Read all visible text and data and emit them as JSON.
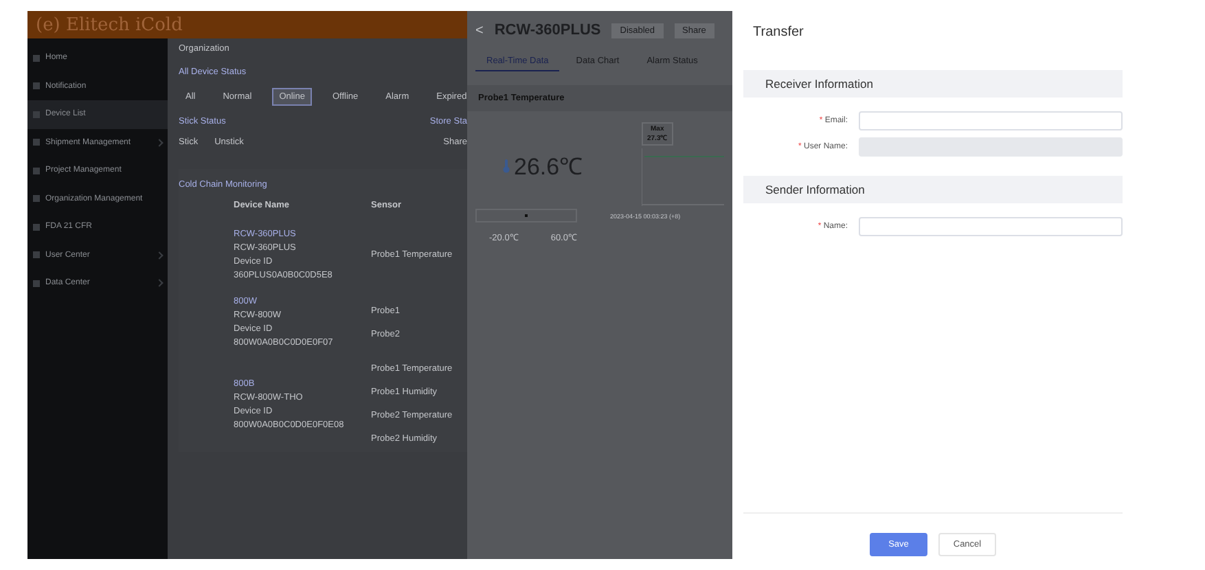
{
  "app": {
    "logo": "(e) Elitech iCold"
  },
  "sidebar": {
    "items": [
      {
        "label": "Home",
        "selected": false,
        "expandable": false
      },
      {
        "label": "Notification",
        "selected": false,
        "expandable": false
      },
      {
        "label": "Device List",
        "selected": true,
        "expandable": false
      },
      {
        "label": "Shipment Management",
        "selected": false,
        "expandable": true
      },
      {
        "label": "Project Management",
        "selected": false,
        "expandable": false
      },
      {
        "label": "Organization Management",
        "selected": false,
        "expandable": false
      },
      {
        "label": "FDA 21 CFR",
        "selected": false,
        "expandable": false
      },
      {
        "label": "User Center",
        "selected": false,
        "expandable": true
      },
      {
        "label": "Data Center",
        "selected": false,
        "expandable": true
      }
    ]
  },
  "main": {
    "breadcrumb": "Organization",
    "status_title": "All Device Status",
    "status_filters": [
      {
        "label": "All",
        "selected": false
      },
      {
        "label": "Normal",
        "selected": false
      },
      {
        "label": "Online",
        "selected": true
      },
      {
        "label": "Offline",
        "selected": false
      },
      {
        "label": "Alarm",
        "selected": false
      },
      {
        "label": "Expired",
        "selected": false
      }
    ],
    "stick_title": "Stick Status",
    "stick_options": [
      "Stick",
      "Unstick"
    ],
    "store_title": "Store Sta",
    "store_options": [
      "Share"
    ],
    "section_title": "Cold Chain Monitoring",
    "table": {
      "columns": [
        "Device Name",
        "Sensor"
      ],
      "rows": [
        {
          "device": [
            "RCW-360PLUS",
            "RCW-360PLUS",
            "Device ID",
            "360PLUS0A0B0C0D5E8"
          ],
          "sensors": [
            "Probe1 Temperature"
          ]
        },
        {
          "device": [
            "800W",
            "RCW-800W",
            "Device ID",
            "800W0A0B0C0D0E0F07"
          ],
          "sensors": [
            "Probe1",
            "Probe2"
          ]
        },
        {
          "device": [
            "800B",
            "RCW-800W-THO",
            "Device ID",
            "800W0A0B0C0D0E0F0E08"
          ],
          "sensors": [
            "Probe1 Temperature",
            "Probe1 Humidity",
            "Probe2 Temperature",
            "Probe2 Humidity"
          ]
        }
      ]
    }
  },
  "device_panel": {
    "title": "RCW-360PLUS",
    "back": "<",
    "buttons": [
      "Disabled",
      "Share"
    ],
    "tabs": [
      {
        "label": "Real-Time Data",
        "selected": true
      },
      {
        "label": "Data Chart",
        "selected": false
      },
      {
        "label": "Alarm Status",
        "selected": false
      }
    ],
    "slider": {
      "level": 0.5
    },
    "probe_title": "Probe1 Temperature",
    "reading": "26.6℃",
    "max_label": "Max",
    "max_value": "27.3℃",
    "timestamp": "2023-04-15 00:03:23 (+8)",
    "range_min": "-20.0℃",
    "range_max": "60.0℃"
  },
  "drawer": {
    "title": "Transfer",
    "required_mark": "*",
    "sections": [
      {
        "title": "Receiver Information",
        "fields": [
          {
            "label": "Email:",
            "required": true,
            "disabled": false
          },
          {
            "label": "User Name:",
            "required": true,
            "disabled": true
          }
        ]
      },
      {
        "title": "Sender Information",
        "fields": [
          {
            "label": "Name:",
            "required": true,
            "disabled": false
          }
        ]
      }
    ],
    "buttons": [
      {
        "label": "Save",
        "kind": "primary"
      },
      {
        "label": "Cancel",
        "kind": "default"
      }
    ]
  }
}
